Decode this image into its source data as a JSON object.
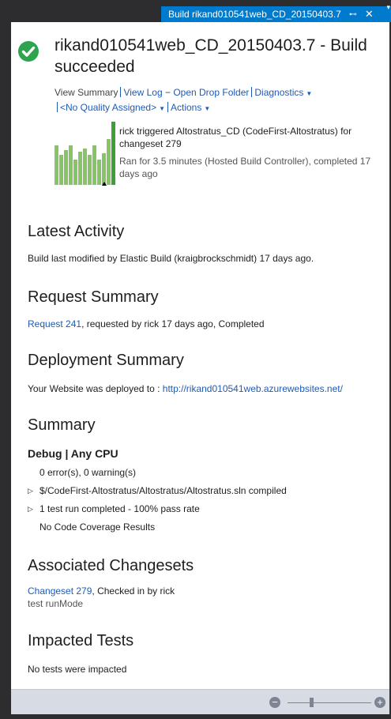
{
  "tab": {
    "title": "Build rikand010541web_CD_20150403.7",
    "pin_glyph": "⊷",
    "close_glyph": "✕",
    "menu_glyph": "▾"
  },
  "header": {
    "title": "rikand010541web_CD_20150403.7 - Build succeeded",
    "status_color": "#2da44e",
    "actions": {
      "view_summary": "View Summary",
      "view_log": "View Log",
      "dash": "−",
      "open_drop_folder": "Open Drop Folder",
      "diagnostics": "Diagnostics",
      "quality": "<No Quality Assigned>",
      "actions": "Actions"
    },
    "trigger": "rick triggered Altostratus_CD (CodeFirst-Altostratus) for changeset 279",
    "ran": "Ran for 3.5 minutes (Hosted Build Controller), completed 17 days ago"
  },
  "history_bars": [
    0.62,
    0.48,
    0.55,
    0.62,
    0.4,
    0.52,
    0.58,
    0.48,
    0.62,
    0.4,
    0.5,
    0.72,
    1.0
  ],
  "latest_activity": {
    "heading": "Latest Activity",
    "text": "Build last modified by Elastic Build (kraigbrockschmidt) 17 days ago."
  },
  "request_summary": {
    "heading": "Request Summary",
    "link": "Request 241",
    "rest": ", requested by rick 17 days ago, Completed"
  },
  "deployment_summary": {
    "heading": "Deployment Summary",
    "label": "Your Website was deployed to : ",
    "url": "http://rikand010541web.azurewebsites.net/"
  },
  "summary": {
    "heading": "Summary",
    "config": "Debug | Any CPU",
    "errors": "0 error(s), 0 warning(s)",
    "solution": "$/CodeFirst-Altostratus/Altostratus/Altostratus.sln compiled",
    "tests": "1 test run completed - 100% pass rate",
    "coverage": "No Code Coverage Results",
    "expander_glyph": "▷"
  },
  "associated_changesets": {
    "heading": "Associated Changesets",
    "link": "Changeset 279",
    "rest": ", Checked in by rick",
    "comment": "test runMode"
  },
  "impacted_tests": {
    "heading": "Impacted Tests",
    "text": "No tests were impacted"
  },
  "zoom": {
    "minus_glyph": "−",
    "plus_glyph": "+",
    "level": 0.28
  }
}
